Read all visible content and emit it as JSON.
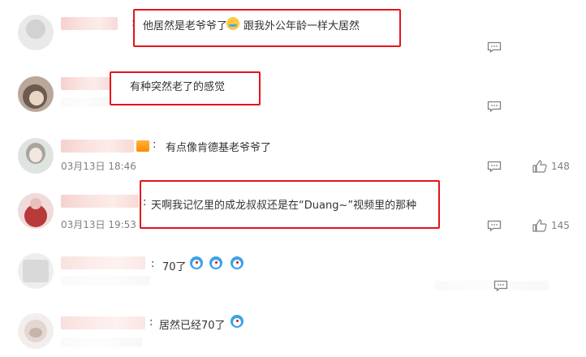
{
  "comments": [
    {
      "text_a": "他居然是老爷爷了",
      "text_b": "跟我外公年龄一样大居然",
      "emoji": "crying-face",
      "colon": ":"
    },
    {
      "text": "有种突然老了的感觉"
    },
    {
      "colon": ":",
      "text": "有点像肯德基老爷爷了",
      "date": "03月13日 18:46",
      "likes": "148",
      "badge": "crown-icon"
    },
    {
      "colon": ":",
      "text": "天啊我记忆里的成龙叔叔还是在“Duang~”视频里的那种",
      "date": "03月13日 19:53",
      "likes": "145"
    },
    {
      "colon": ":",
      "text": "70了",
      "emoji": "doraemon-face"
    },
    {
      "colon": ":",
      "text": "居然已经70了",
      "emoji": "doraemon-face"
    }
  ],
  "icons": {
    "reply": "comment-icon",
    "like": "thumbs-up-icon"
  },
  "colors": {
    "highlight_box": "#e4141b",
    "meta_text": "#808080"
  }
}
